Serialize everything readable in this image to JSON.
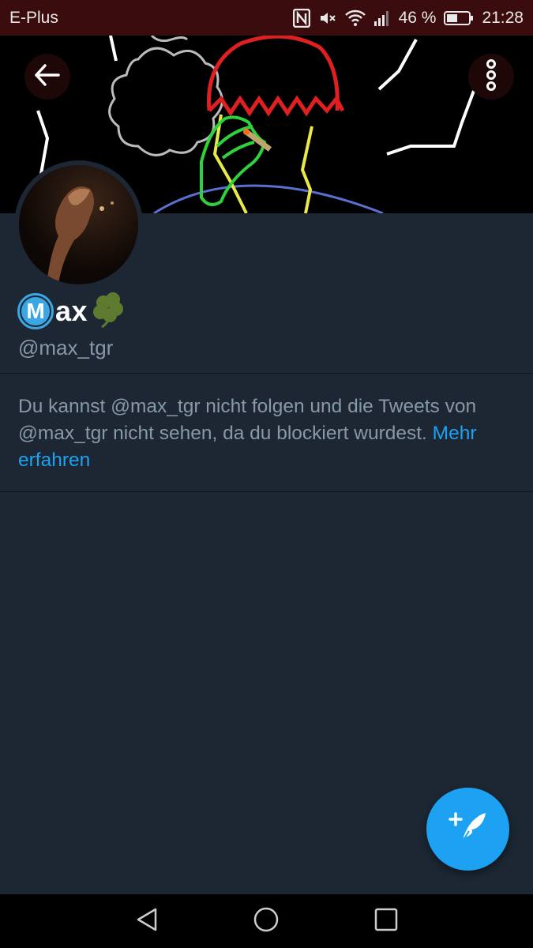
{
  "status_bar": {
    "carrier": "E-Plus",
    "battery": "46 %",
    "time": "21:28",
    "icons": [
      "nfc-icon",
      "mute-icon",
      "wifi-icon",
      "signal-icon",
      "battery-icon"
    ]
  },
  "header": {
    "back_icon": "arrow-left-icon",
    "more_icon": "more-vertical-icon"
  },
  "profile": {
    "name_badge": "M",
    "name": "ax",
    "emoji_icon": "shamrock-icon",
    "handle": "@max_tgr"
  },
  "blocked": {
    "message": "Du kannst @max_tgr nicht folgen und die Tweets von @max_tgr nicht sehen, da du blockiert wurdest. ",
    "link": "Mehr erfahren"
  },
  "fab": {
    "icon": "compose-tweet-icon"
  },
  "colors": {
    "background": "#1c2733",
    "accent": "#1da1f2",
    "muted_text": "#8899a6",
    "status_bar": "#3b0c0e"
  }
}
